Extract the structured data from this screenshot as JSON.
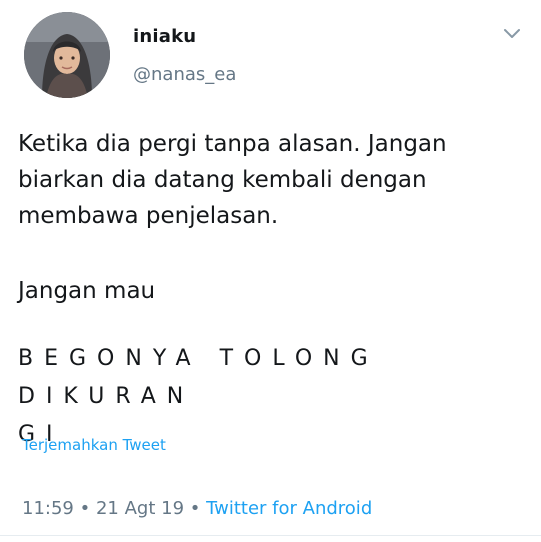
{
  "tweet": {
    "display_name": "iniaku",
    "handle": "@nanas_ea",
    "text_line1": "Ketika dia pergi tanpa alasan. Jangan",
    "text_line2": "biarkan dia datang kembali dengan",
    "text_line3": "membawa penjelasan.",
    "text_para2": "Jangan mau",
    "caps_line1": "BEGONYA TOLONG DIKURAN",
    "caps_line2": "GI",
    "translate_label": "Terjemahkan Tweet",
    "time": "11:59",
    "date": "21 Agt 19",
    "source": "Twitter for Android",
    "separator": "•"
  },
  "icons": {
    "avatar": "user-avatar",
    "caret": "chevron-down-icon"
  },
  "colors": {
    "text": "#14171a",
    "muted": "#657786",
    "link": "#1da1f2"
  }
}
